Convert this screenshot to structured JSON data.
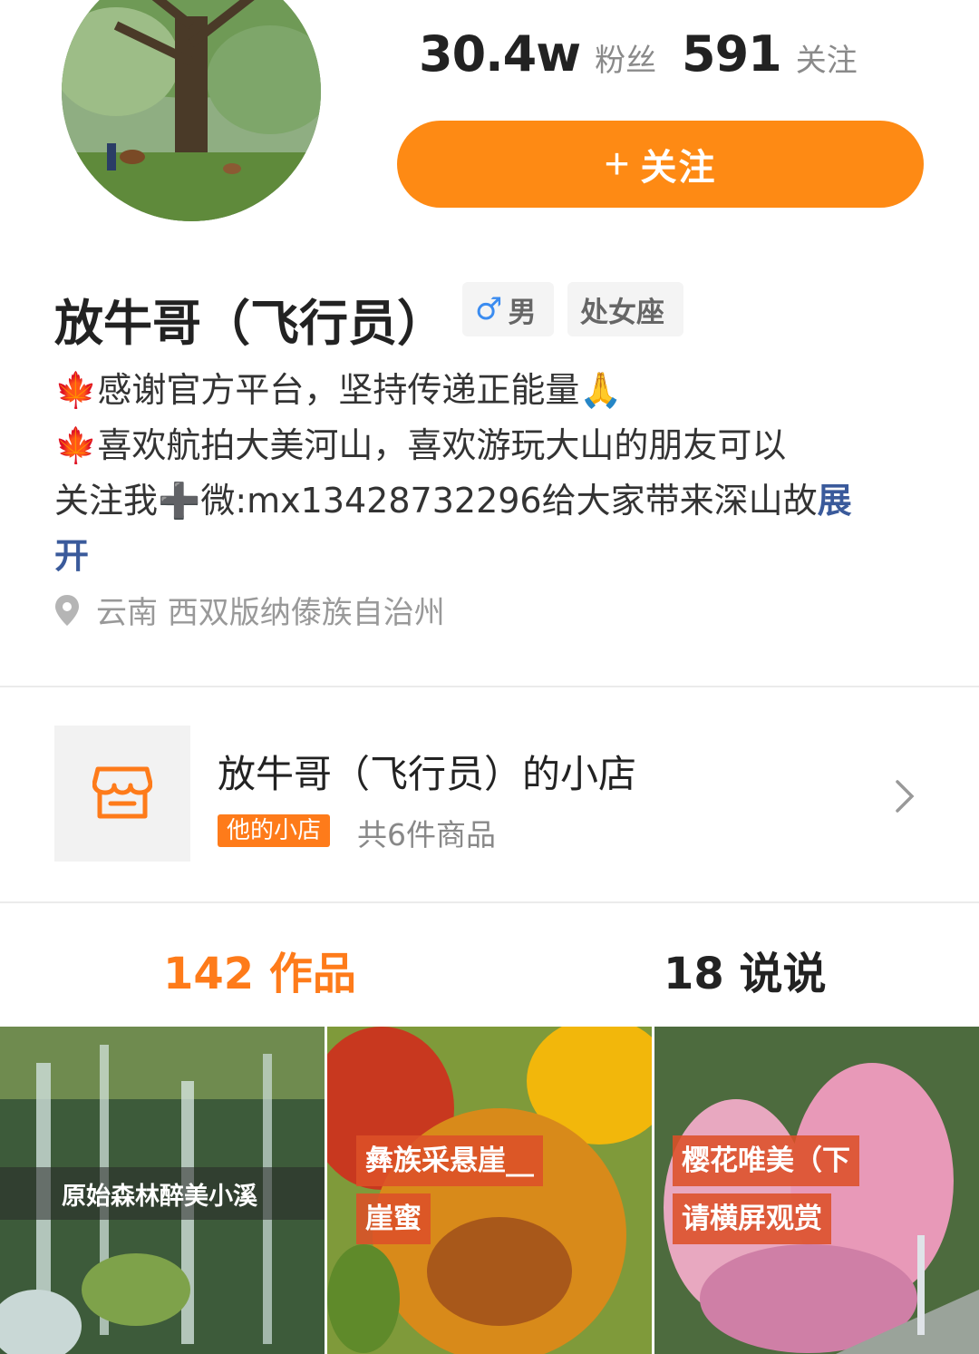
{
  "profile": {
    "fans_count": "30.4w",
    "fans_label": "粉丝",
    "following_count": "591",
    "following_label": "关注",
    "follow_button_plus": "+",
    "follow_button_label": "关注",
    "name": "放牛哥（飞行员）",
    "gender_symbol": "♂",
    "gender": "男",
    "zodiac": "处女座",
    "bio_line1": "感谢官方平台，坚持传递正能量",
    "bio_line2": "喜欢航拍大美河山，喜欢游玩大山的朋友可以",
    "bio_line3": "关注我",
    "bio_line3b": "微:mx13428732296给大家带来深山故",
    "bio_expand_a": "展",
    "bio_expand_b": "开",
    "location": "云南 西双版纳傣族自治州"
  },
  "shop": {
    "title": "放牛哥（飞行员）的小店",
    "badge": "他的小店",
    "count": "共6件商品",
    "chevron_icon": "chevron-right-icon"
  },
  "tabs": {
    "works": "142 作品",
    "posts": "18 说说"
  },
  "videos": [
    {
      "title": "原始森林醉美小溪"
    },
    {
      "caption_line1": "彝族采悬崖__",
      "caption_line2": "崖蜜"
    },
    {
      "caption_line1": "樱花唯美（下",
      "caption_line2": "请横屏观赏"
    }
  ],
  "colors": {
    "accent": "#fe8a14",
    "tab_active": "#fe7b1a",
    "expand_link": "#3a5a9b"
  }
}
